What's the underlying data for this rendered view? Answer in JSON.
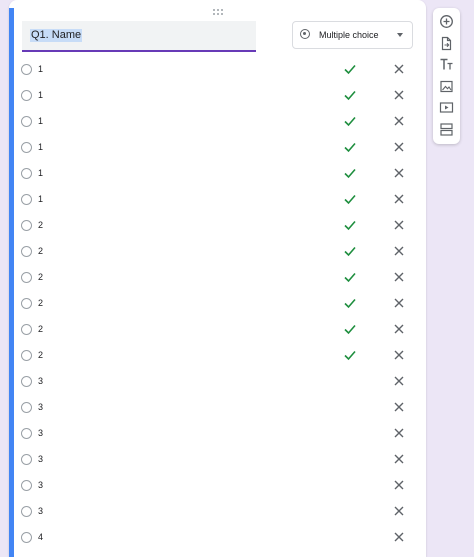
{
  "question": {
    "title": "Q1. Name",
    "type_label": "Multiple choice",
    "type_icon": "radio-button-icon"
  },
  "colors": {
    "accent": "#4285f4",
    "underline": "#673ab7",
    "check": "#1e8e3e",
    "background": "#ece6f6"
  },
  "options": [
    {
      "label": "1",
      "correct": true
    },
    {
      "label": "1",
      "correct": true
    },
    {
      "label": "1",
      "correct": true
    },
    {
      "label": "1",
      "correct": true
    },
    {
      "label": "1",
      "correct": true
    },
    {
      "label": "1",
      "correct": true
    },
    {
      "label": "2",
      "correct": true
    },
    {
      "label": "2",
      "correct": true
    },
    {
      "label": "2",
      "correct": true
    },
    {
      "label": "2",
      "correct": true
    },
    {
      "label": "2",
      "correct": true
    },
    {
      "label": "2",
      "correct": true
    },
    {
      "label": "3",
      "correct": false
    },
    {
      "label": "3",
      "correct": false
    },
    {
      "label": "3",
      "correct": false
    },
    {
      "label": "3",
      "correct": false
    },
    {
      "label": "3",
      "correct": false
    },
    {
      "label": "3",
      "correct": false
    },
    {
      "label": "4",
      "correct": false
    }
  ],
  "toolbar": [
    {
      "icon": "add-question-icon"
    },
    {
      "icon": "import-questions-icon"
    },
    {
      "icon": "add-title-icon"
    },
    {
      "icon": "add-image-icon"
    },
    {
      "icon": "add-video-icon"
    },
    {
      "icon": "add-section-icon"
    }
  ]
}
